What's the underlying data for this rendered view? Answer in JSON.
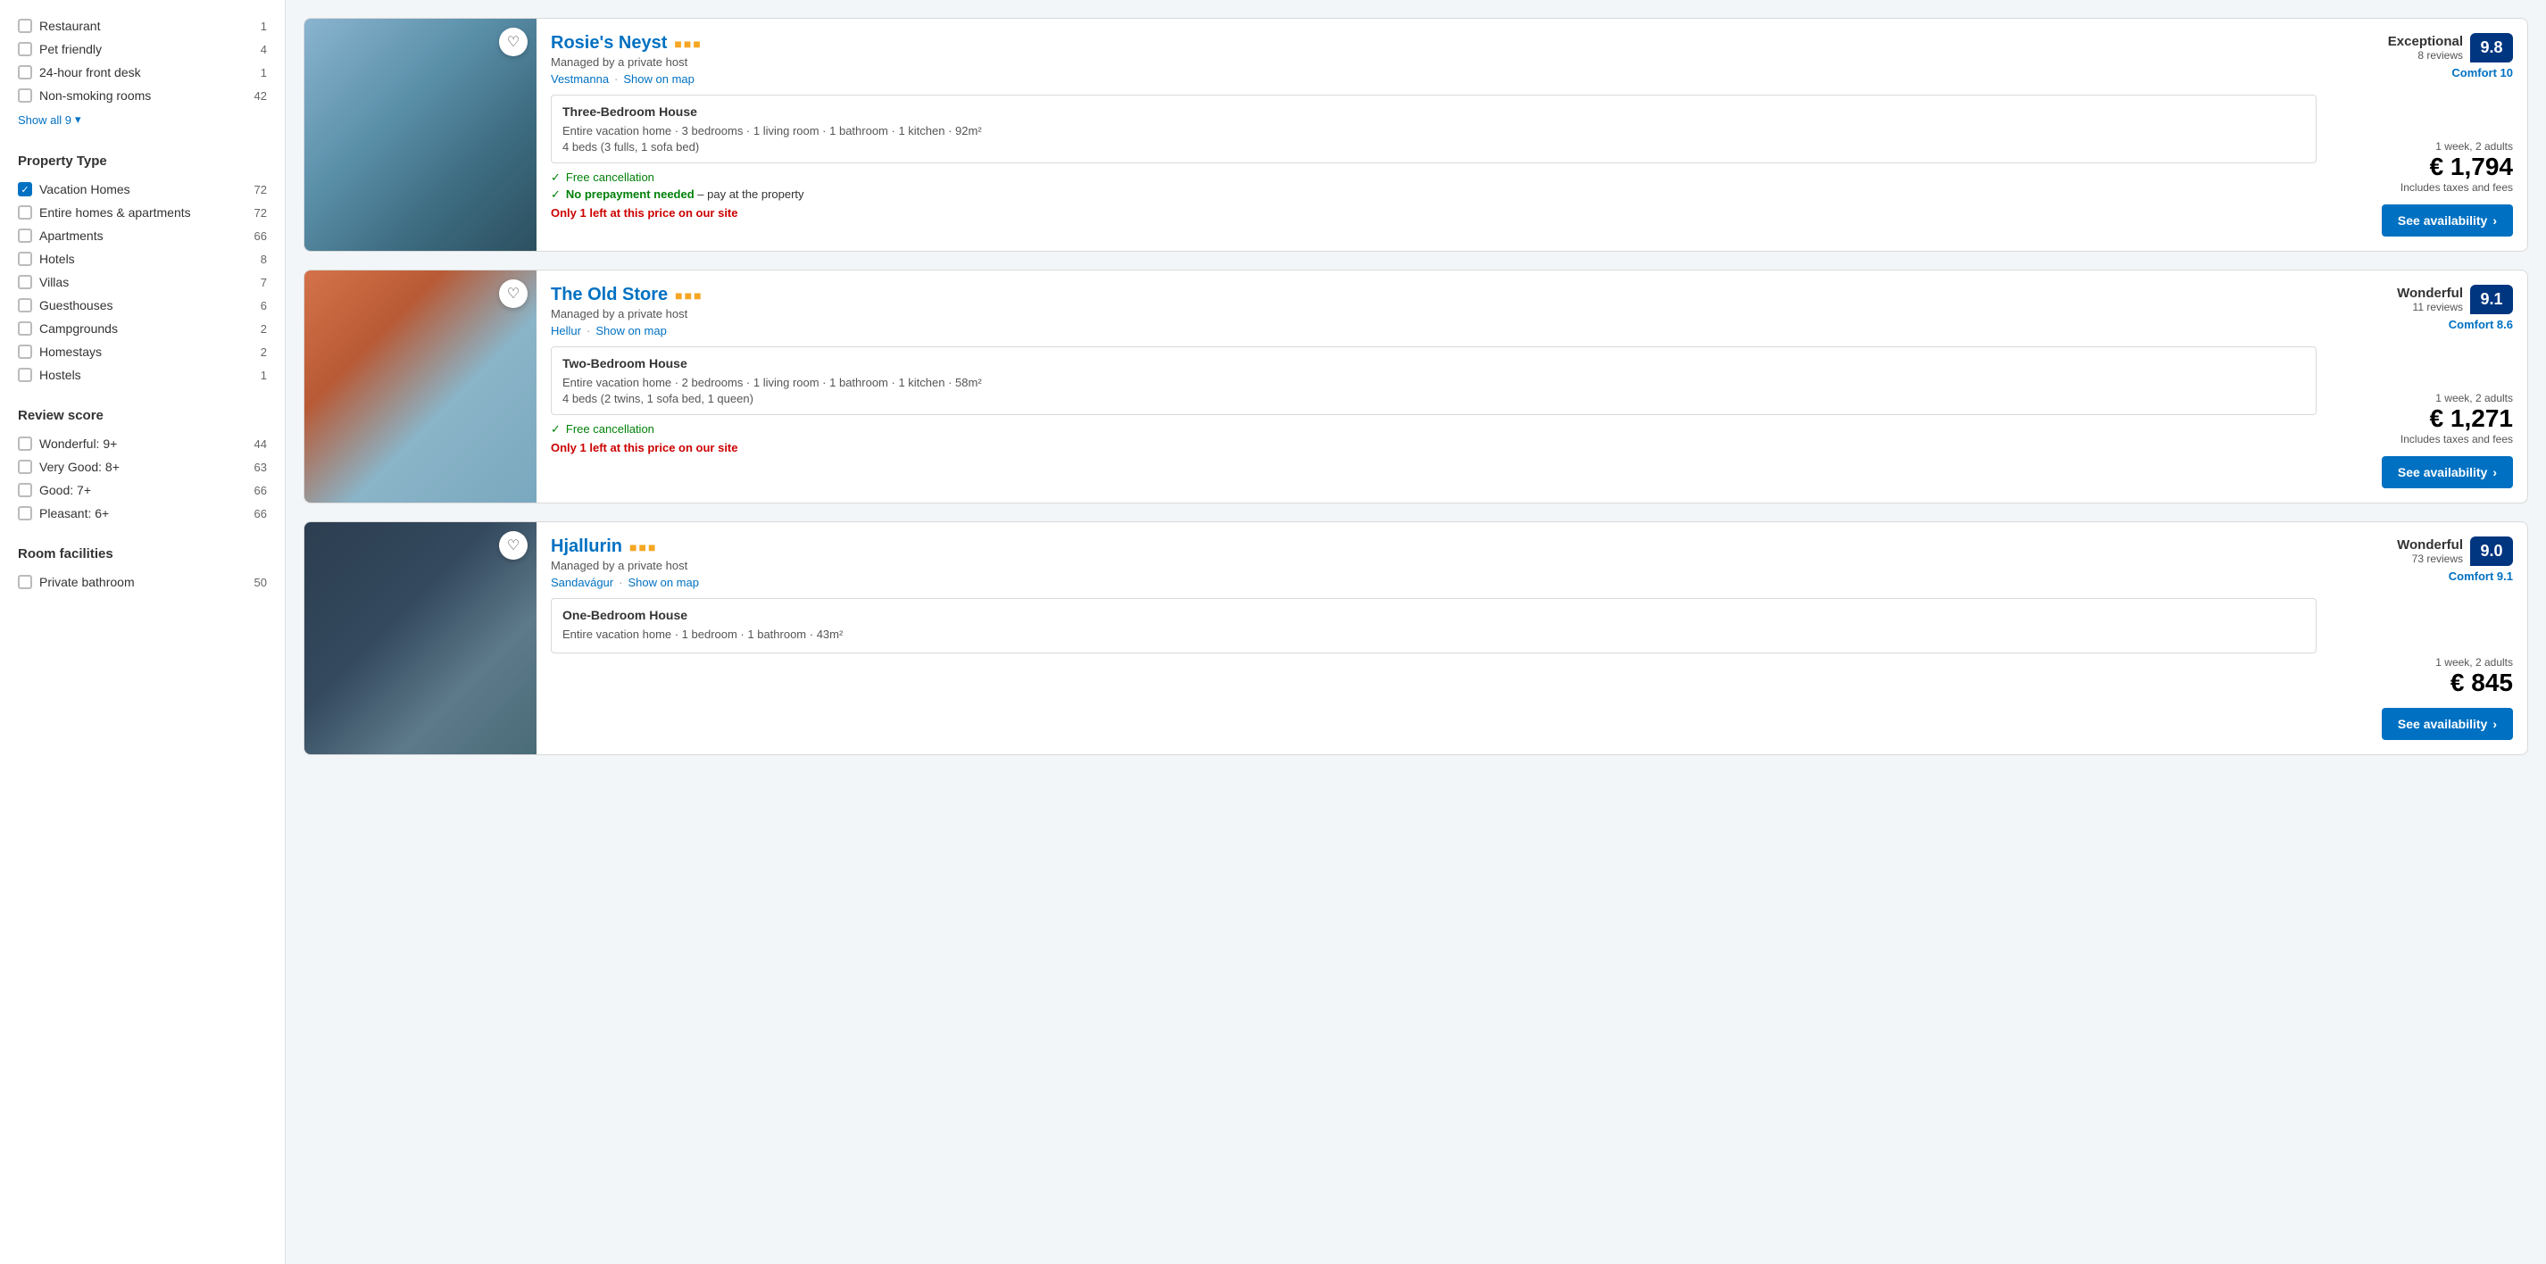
{
  "sidebar": {
    "facilities_section": {
      "items": [
        {
          "label": "Restaurant",
          "count": 1,
          "checked": false
        },
        {
          "label": "Pet friendly",
          "count": 4,
          "checked": false
        },
        {
          "label": "24-hour front desk",
          "count": 1,
          "checked": false
        },
        {
          "label": "Non-smoking rooms",
          "count": 42,
          "checked": false
        }
      ],
      "show_all_label": "Show all 9",
      "show_all_chevron": "▾"
    },
    "property_type_section": {
      "title": "Property Type",
      "items": [
        {
          "label": "Vacation Homes",
          "count": 72,
          "checked": true
        },
        {
          "label": "Entire homes & apartments",
          "count": 72,
          "checked": false
        },
        {
          "label": "Apartments",
          "count": 66,
          "checked": false
        },
        {
          "label": "Hotels",
          "count": 8,
          "checked": false
        },
        {
          "label": "Villas",
          "count": 7,
          "checked": false
        },
        {
          "label": "Guesthouses",
          "count": 6,
          "checked": false
        },
        {
          "label": "Campgrounds",
          "count": 2,
          "checked": false
        },
        {
          "label": "Homestays",
          "count": 2,
          "checked": false
        },
        {
          "label": "Hostels",
          "count": 1,
          "checked": false
        }
      ]
    },
    "review_score_section": {
      "title": "Review score",
      "items": [
        {
          "label": "Wonderful: 9+",
          "count": 44,
          "checked": false
        },
        {
          "label": "Very Good: 8+",
          "count": 63,
          "checked": false
        },
        {
          "label": "Good: 7+",
          "count": 66,
          "checked": false
        },
        {
          "label": "Pleasant: 6+",
          "count": 66,
          "checked": false
        }
      ]
    },
    "room_facilities_section": {
      "title": "Room facilities",
      "items": [
        {
          "label": "Private bathroom",
          "count": 50,
          "checked": false
        }
      ]
    }
  },
  "listings": [
    {
      "id": "rosies-neyst",
      "name": "Rosie's Neyst",
      "stars": 3,
      "managed_by": "Managed by a private host",
      "location": "Vestmanna",
      "show_on_map": "Show on map",
      "score_label": "Exceptional",
      "score_reviews": "8 reviews",
      "score_value": "9.8",
      "comfort_label": "Comfort 10",
      "room_type": "Three-Bedroom House",
      "room_desc": "Entire vacation home · 3 bedrooms · 1 living room · 1 bathroom · 1 kitchen · 92m²",
      "room_beds": "4 beds (3 fulls, 1 sofa bed)",
      "perks": [
        {
          "type": "green-check",
          "text": "Free cancellation"
        },
        {
          "type": "green-check-highlight",
          "text": "No prepayment needed",
          "suffix": " – pay at the property"
        },
        {
          "type": "alert",
          "text": "Only 1 left at this price on our site"
        }
      ],
      "duration": "1 week, 2 adults",
      "price": "€ 1,794",
      "price_note": "Includes taxes and fees",
      "avail_btn": "See availability"
    },
    {
      "id": "the-old-store",
      "name": "The Old Store",
      "stars": 3,
      "managed_by": "Managed by a private host",
      "location": "Hellur",
      "show_on_map": "Show on map",
      "score_label": "Wonderful",
      "score_reviews": "11 reviews",
      "score_value": "9.1",
      "comfort_label": "Comfort 8.6",
      "room_type": "Two-Bedroom House",
      "room_desc": "Entire vacation home · 2 bedrooms · 1 living room · 1 bathroom · 1 kitchen · 58m²",
      "room_beds": "4 beds (2 twins, 1 sofa bed, 1 queen)",
      "perks": [
        {
          "type": "green-check",
          "text": "Free cancellation"
        },
        {
          "type": "alert",
          "text": "Only 1 left at this price on our site"
        }
      ],
      "duration": "1 week, 2 adults",
      "price": "€ 1,271",
      "price_note": "Includes taxes and fees",
      "avail_btn": "See availability"
    },
    {
      "id": "hjallurin",
      "name": "Hjallurin",
      "stars": 3,
      "managed_by": "Managed by a private host",
      "location": "Sandavágur",
      "show_on_map": "Show on map",
      "score_label": "Wonderful",
      "score_reviews": "73 reviews",
      "score_value": "9.0",
      "comfort_label": "Comfort 9.1",
      "room_type": "One-Bedroom House",
      "room_desc": "Entire vacation home · 1 bedroom · 1 bathroom · 43m²",
      "room_beds": "",
      "perks": [],
      "duration": "1 week, 2 adults",
      "price": "€ 845",
      "price_note": "",
      "avail_btn": "See availability"
    }
  ]
}
